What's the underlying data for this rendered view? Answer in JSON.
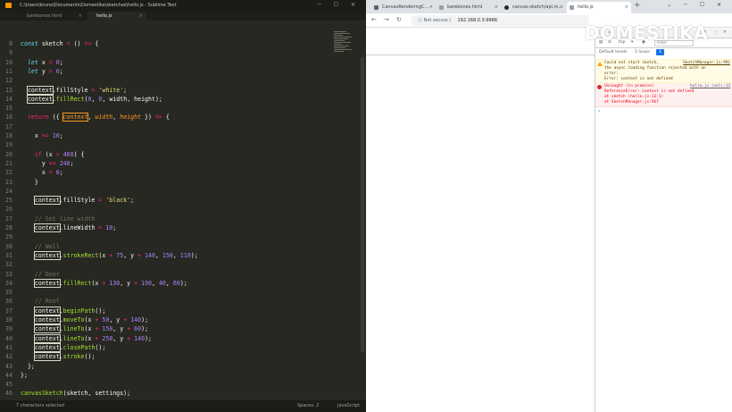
{
  "sublime": {
    "title": "C:\\Users\\bruno\\Documents\\Domestika\\sketches\\hello.js - Sublime Text",
    "tabs": [
      "barebones.html",
      "hello.js"
    ],
    "status": {
      "selection": "7 characters selected",
      "spaces": "Spaces: 2",
      "syntax": "JavaScript"
    },
    "lines": [
      {
        "n": "8",
        "t": "const sketch = () => {"
      },
      {
        "n": "9",
        "t": ""
      },
      {
        "n": "10",
        "t": "  let x = 0;"
      },
      {
        "n": "11",
        "t": "  let y = 0;"
      },
      {
        "n": "12",
        "t": ""
      },
      {
        "n": "13",
        "t": "  context.fillStyle = 'white';"
      },
      {
        "n": "14",
        "t": "  context.fillRect(0, 0, width, height);"
      },
      {
        "n": "15",
        "t": ""
      },
      {
        "n": "16",
        "t": "  return ({ context, width, height }) => {"
      },
      {
        "n": "17",
        "t": ""
      },
      {
        "n": "18",
        "t": "    x += 10;"
      },
      {
        "n": "19",
        "t": ""
      },
      {
        "n": "20",
        "t": "    if (x > 460) {"
      },
      {
        "n": "21",
        "t": "      y += 240;"
      },
      {
        "n": "22",
        "t": "      x = 0;"
      },
      {
        "n": "23",
        "t": "    }"
      },
      {
        "n": "24",
        "t": ""
      },
      {
        "n": "25",
        "t": "    context.fillStyle = 'black';"
      },
      {
        "n": "26",
        "t": ""
      },
      {
        "n": "27",
        "t": "    // Set line width"
      },
      {
        "n": "28",
        "t": "    context.lineWidth = 10;"
      },
      {
        "n": "29",
        "t": ""
      },
      {
        "n": "30",
        "t": "    // Wall"
      },
      {
        "n": "31",
        "t": "    context.strokeRect(x + 75, y + 140, 150, 110);"
      },
      {
        "n": "32",
        "t": ""
      },
      {
        "n": "33",
        "t": "    // Door"
      },
      {
        "n": "34",
        "t": "    context.fillRect(x + 130, y + 190, 40, 60);"
      },
      {
        "n": "35",
        "t": ""
      },
      {
        "n": "36",
        "t": "    // Roof"
      },
      {
        "n": "37",
        "t": "    context.beginPath();"
      },
      {
        "n": "38",
        "t": "    context.moveTo(x + 50, y + 140);"
      },
      {
        "n": "39",
        "t": "    context.lineTo(x + 150, y + 60);"
      },
      {
        "n": "40",
        "t": "    context.lineTo(x + 250, y + 140);"
      },
      {
        "n": "41",
        "t": "    context.closePath();"
      },
      {
        "n": "42",
        "t": "    context.stroke();"
      },
      {
        "n": "43",
        "t": "  };"
      },
      {
        "n": "44",
        "t": "};"
      },
      {
        "n": "45",
        "t": ""
      },
      {
        "n": "46",
        "t": "canvasSketch(sketch, settings);"
      }
    ]
  },
  "chrome": {
    "tabs": [
      "CanvasRenderingC...",
      "barebones.html",
      "canvas-sketch/api.m...",
      "hello.js"
    ],
    "address": {
      "security": "Not secure",
      "url": "192.168.0.3:9966"
    }
  },
  "devtools": {
    "context": "top",
    "filter_placeholder": "Filter",
    "levels": "Default levels",
    "issues": "1 Issue:",
    "issue_count": "1",
    "warning": {
      "lines": [
        "Could not start sketch,",
        "the async loading function rejected with an",
        "error:",
        "    Error: context is not defined"
      ],
      "source": "SketchManager.js:991"
    },
    "error": {
      "lines": [
        "Uncaught (in promise)",
        "ReferenceError: context is not defined",
        "    at sketch (hello.js:13:1)",
        "    at SketchManager.js:967"
      ],
      "source": "hello.js (sel):13"
    },
    "prompt": "›"
  },
  "watermark": "DOMESTIKA"
}
